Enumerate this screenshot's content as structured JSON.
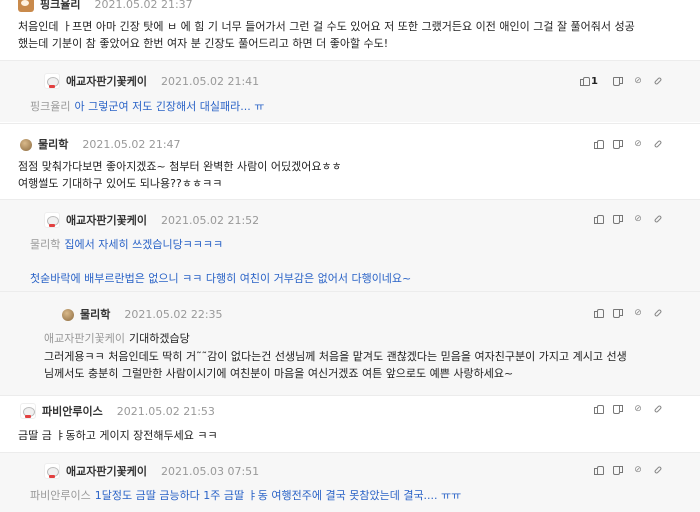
{
  "comments": [
    {
      "id": "c1",
      "nick": "핑크율리",
      "date": "2021.05.02 21:37",
      "avatar": "dog-icon",
      "lines": [
        "처음인데 ㅏ프면 아마 긴장 탓에 ㅂ 에 힘 기 너무 들어가서 그런 걸 수도 있어요 저 또한 그랬거든요 이전 애인이 그걸 잘 풀어줘서 성공",
        "했는데 기분이 참 좋았어요 한번 여자 분 긴장도 풀어드리고 하면 더 좋아할 수도!"
      ]
    },
    {
      "id": "r1",
      "nick": "애교자판기꽃케이",
      "date": "2021.05.02 21:41",
      "avatar": "bear-icon",
      "mention": "핑크율리",
      "text": "아 그렇군여 저도 긴장해서 대실패라... ㅠ",
      "likes": "1"
    },
    {
      "id": "c2",
      "nick": "물리학",
      "date": "2021.05.02 21:47",
      "avatar": "brown-dot-icon",
      "lines": [
        "점점 맞춰가다보면 좋아지겠죠~ 첨부터 완벽한 사람이 어딨겠어요ㅎㅎ",
        "여행썰도 기대하구 있어도 되나용??ㅎㅎㅋㅋ"
      ]
    },
    {
      "id": "r2",
      "nick": "애교자판기꽃케이",
      "date": "2021.05.02 21:52",
      "avatar": "bear-icon",
      "mention": "물리학",
      "text": "집에서 자세히 쓰겠습니당ㅋㅋㅋㅋ",
      "text2": "첫숟바락에 배부르란법은 없으니 ㅋㅋ 다행히 여친이 거부감은 없어서 다행이네요~"
    },
    {
      "id": "r3",
      "nick": "물리학",
      "date": "2021.05.02 22:35",
      "avatar": "brown-dot-icon",
      "mention": "애교자판기꽃케이",
      "text": "기대하겠습당",
      "lines": [
        "그러게용ㅋㅋ 처음인데도 딱히 거˜˜감이 없다는건 선생님께 처음을 맡겨도 괜찮겠다는 믿음을 여자친구분이 가지고 계시고 선생",
        "님께서도 충분히 그럴만한 사람이시기에 여친분이 마음을 여신거겠죠 여튼 앞으로도 예쁜 사랑하세요~"
      ]
    },
    {
      "id": "c3",
      "nick": "파비안루이스",
      "date": "2021.05.02 21:53",
      "avatar": "bear-icon",
      "lines": [
        "금딸 금  ㅑ동하고 게이지 장전해두세요 ㅋㅋ"
      ]
    },
    {
      "id": "r4",
      "nick": "애교자판기꽃케이",
      "date": "2021.05.03 07:51",
      "avatar": "bear-icon",
      "mention": "파비안루이스",
      "text": "1달정도 금딸 금능하다 1주 금딸 ㅑ동 여행전주에 결국 못참았는데 결국.... ㅠㅠ"
    }
  ],
  "colors": {
    "accent": "#2a63c7",
    "muted": "#999999",
    "reply_bg": "#f7f7f7"
  }
}
